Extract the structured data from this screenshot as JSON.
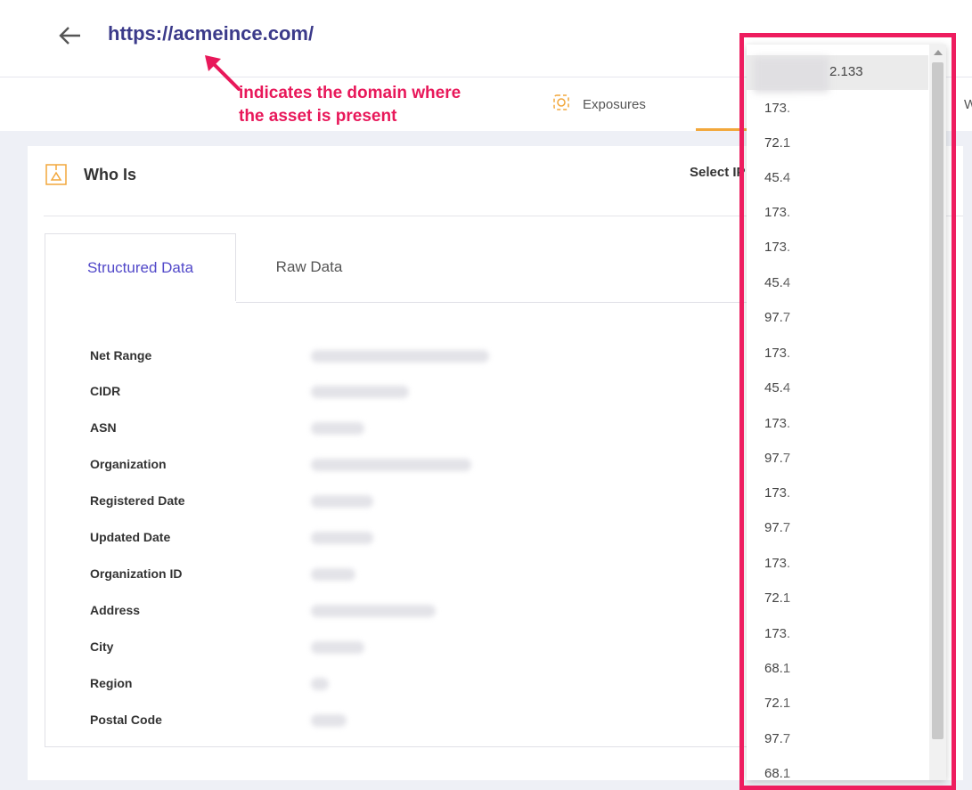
{
  "header": {
    "url": "https://acmeince.com/"
  },
  "tabs": {
    "exposures_label": "Exposures",
    "partial_label": "W"
  },
  "annotation": {
    "line1": "indicates the domain where",
    "line2": "the asset is present",
    "color": "#e8185a"
  },
  "whois": {
    "title": "Who Is",
    "select_ip_label": "Select IP",
    "tabs": [
      "Structured Data",
      "Raw Data"
    ],
    "fields": [
      "Net Range",
      "CIDR",
      "ASN",
      "Organization",
      "Registered Date",
      "Updated Date",
      "Organization ID",
      "Address",
      "City",
      "Region",
      "Postal Code"
    ]
  },
  "ip_dropdown": {
    "selected_suffix": "2.133",
    "items": [
      "173.",
      "72.1",
      "45.4",
      "173.",
      "173.",
      "45.4",
      "97.7",
      "173.",
      "45.4",
      "173.",
      "97.7",
      "173.",
      "97.7",
      "173.",
      "72.1",
      "173.",
      "68.1",
      "72.1",
      "97.7",
      "68.1"
    ]
  },
  "colors": {
    "url_color": "#3b3a8a",
    "active_tab_color": "#5148c9",
    "highlight": "#ee1d5f",
    "accent_orange": "#f2a73b"
  }
}
